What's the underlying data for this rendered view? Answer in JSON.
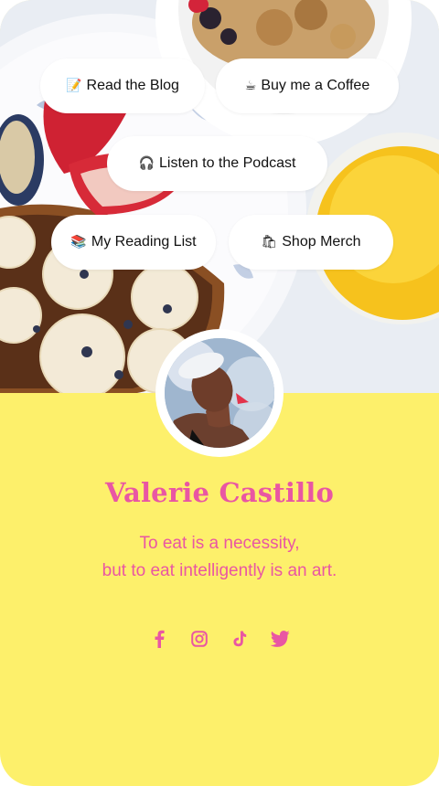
{
  "links": [
    {
      "emoji": "📝",
      "label": "Read the Blog"
    },
    {
      "emoji": "☕",
      "label": "Buy me a Coffee"
    },
    {
      "emoji": "🎧",
      "label": "Listen to the Podcast"
    },
    {
      "emoji": "📚",
      "label": "My Reading List"
    },
    {
      "emoji": "🛍",
      "label": "Shop Merch"
    }
  ],
  "profile": {
    "name": "Valerie Castillo",
    "bio_line_1": "To eat is a necessity,",
    "bio_line_2": "but to eat intelligently is an art."
  },
  "socials": [
    "facebook-icon",
    "instagram-icon",
    "tiktok-icon",
    "twitter-icon"
  ],
  "colors": {
    "background": "#fdf06b",
    "accent": "#e956a3",
    "button": "#ffffff"
  }
}
